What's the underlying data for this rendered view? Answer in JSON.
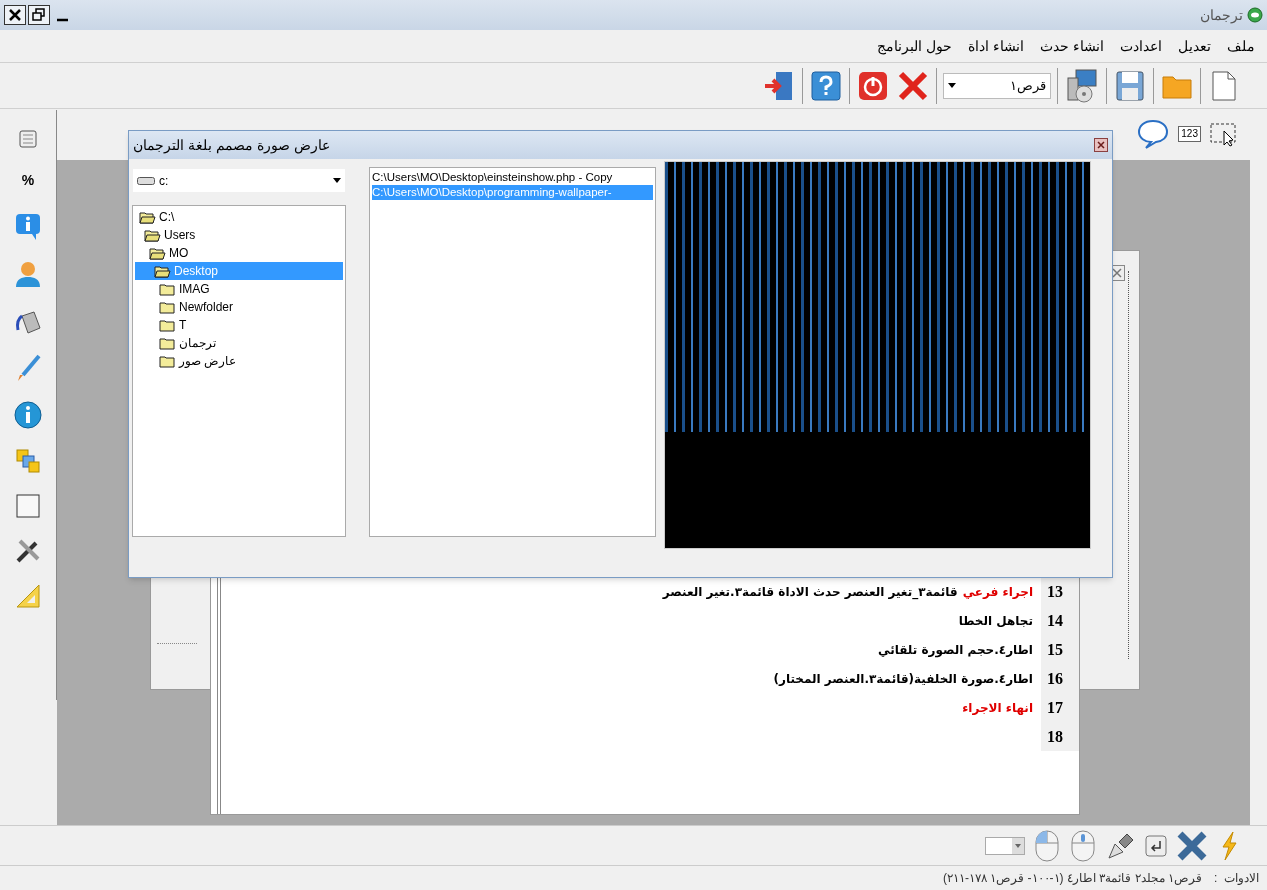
{
  "window": {
    "title": "ترجمان"
  },
  "menu": [
    "ملف",
    "تعديل",
    "اعدادت",
    "انشاء حدث",
    "انشاء اداة",
    "حول البرنامج"
  ],
  "toolbar": {
    "drive_combo": "قرص١"
  },
  "palette_toolbar": {
    "number_tool": "123"
  },
  "side_toolbar": {
    "percent_tool": "%"
  },
  "dialog": {
    "title": "عارض صورة مصمم بلغة الترجمان",
    "drive_combo": "c:",
    "tree": [
      {
        "label": "C:\\",
        "expanded": true,
        "selected": false,
        "children": [
          {
            "label": "Users",
            "expanded": true,
            "selected": false,
            "children": [
              {
                "label": "MO",
                "expanded": true,
                "selected": false,
                "children": [
                  {
                    "label": "Desktop",
                    "expanded": true,
                    "selected": true,
                    "children": [
                      {
                        "label": "IMAG",
                        "expanded": false,
                        "selected": false
                      },
                      {
                        "label": "Newfolder",
                        "expanded": false,
                        "selected": false
                      },
                      {
                        "label": "T",
                        "expanded": false,
                        "selected": false
                      },
                      {
                        "label": "ترجمان",
                        "expanded": false,
                        "selected": false
                      },
                      {
                        "label": "عارض صور",
                        "expanded": false,
                        "selected": false
                      }
                    ]
                  }
                ]
              }
            ]
          }
        ]
      }
    ],
    "files": [
      {
        "path": "C:\\Users\\MO\\Desktop\\einsteinshow.php - Copy",
        "selected": false
      },
      {
        "path": "C:\\Users\\MO\\Desktop\\programming-wallpaper-",
        "selected": true
      }
    ]
  },
  "editor": {
    "lines": [
      {
        "number": "13",
        "segments": [
          {
            "text": "اجراء فرعي",
            "kind": "keyword"
          },
          {
            "text": "قائمة٣_تغير العنصر حدث الاداة قائمة٣.تغير العنصر",
            "kind": "plain"
          }
        ]
      },
      {
        "number": "14",
        "segments": [
          {
            "text": "تجاهل الخطا",
            "kind": "plain"
          }
        ]
      },
      {
        "number": "15",
        "segments": [
          {
            "text": "اطار٤.حجم الصورة تلقائي",
            "kind": "plain"
          }
        ]
      },
      {
        "number": "16",
        "segments": [
          {
            "text": "اطار٤.صورة الخلفية(قائمة٣.العنصر المختار)",
            "kind": "plain"
          }
        ]
      },
      {
        "number": "17",
        "segments": [
          {
            "text": "انهاء الاجراء",
            "kind": "keyword"
          }
        ]
      },
      {
        "number": "18"
      }
    ]
  },
  "status_bar": {
    "label": "الادوات  :",
    "value": "قرص١ مجلد٢ قائمة٣ اطار٤ (١-١٠٠- قرص١ ١٧٨-٢١١)"
  }
}
